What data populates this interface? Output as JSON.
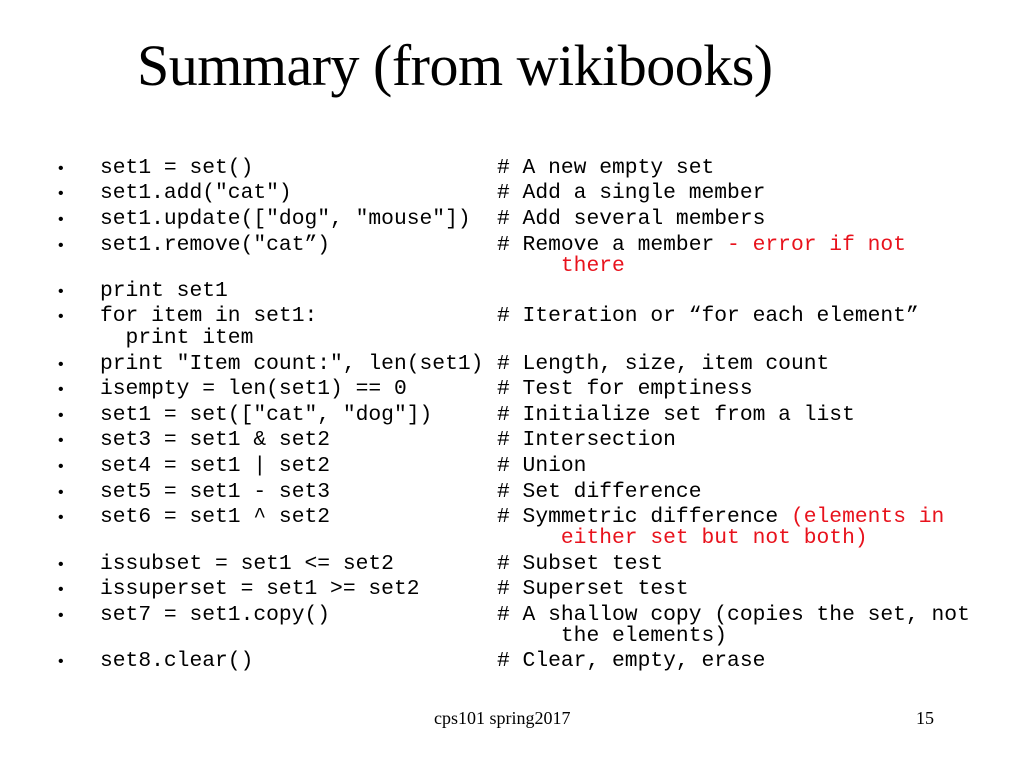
{
  "slide": {
    "title": "Summary (from wikibooks)",
    "accent_color": "#e8121c",
    "bullet_glyph": "•",
    "rows": [
      {
        "code": "set1 = set()",
        "comment": "# A new empty set",
        "comment_red": "",
        "comment_cont": ""
      },
      {
        "code": "set1.add(\"cat\")",
        "comment": "# Add a single member",
        "comment_red": "",
        "comment_cont": ""
      },
      {
        "code": "set1.update([\"dog\", \"mouse\"])",
        "comment": "# Add several members",
        "comment_red": "",
        "comment_cont": ""
      },
      {
        "code": "set1.remove(\"cat”)",
        "comment": "# Remove a member ",
        "comment_red": "- error if not",
        "comment_cont": "     there"
      },
      {
        "code": "print set1",
        "comment": "",
        "comment_red": "",
        "comment_cont": ""
      },
      {
        "code": "for item in set1:",
        "code_cont": "  print item",
        "comment": "# Iteration or “for each element”",
        "comment_red": "",
        "comment_cont": ""
      },
      {
        "code": "print \"Item count:\", len(set1)",
        "comment": "# Length, size, item count",
        "comment_red": "",
        "comment_cont": ""
      },
      {
        "code": "isempty = len(set1) == 0",
        "comment": "# Test for emptiness",
        "comment_red": "",
        "comment_cont": ""
      },
      {
        "code": "set1 = set([\"cat\", \"dog\"])",
        "comment": "# Initialize set from a list",
        "comment_red": "",
        "comment_cont": ""
      },
      {
        "code": "set3 = set1 & set2",
        "comment": "# Intersection",
        "comment_red": "",
        "comment_cont": ""
      },
      {
        "code": "set4 = set1 | set2",
        "comment": "# Union",
        "comment_red": "",
        "comment_cont": ""
      },
      {
        "code": "set5 = set1 - set3",
        "comment": "# Set difference",
        "comment_red": "",
        "comment_cont": ""
      },
      {
        "code": "set6 = set1 ^ set2",
        "comment": "# Symmetric difference ",
        "comment_red": "(elements in",
        "comment_cont_red": "     either set but not both)"
      },
      {
        "code": "issubset = set1 <= set2",
        "comment": "# Subset test",
        "comment_red": "",
        "comment_cont": ""
      },
      {
        "code": "issuperset = set1 >= set2",
        "comment": "# Superset test",
        "comment_red": "",
        "comment_cont": ""
      },
      {
        "code": "set7 = set1.copy()",
        "comment": "# A shallow copy (copies the set, not",
        "comment_red": "",
        "comment_cont": "     the elements)"
      },
      {
        "code": "set8.clear()",
        "comment": "# Clear, empty, erase",
        "comment_red": "",
        "comment_cont": ""
      }
    ]
  },
  "footer": {
    "center_text": "cps101 spring2017",
    "page_number": "15"
  }
}
